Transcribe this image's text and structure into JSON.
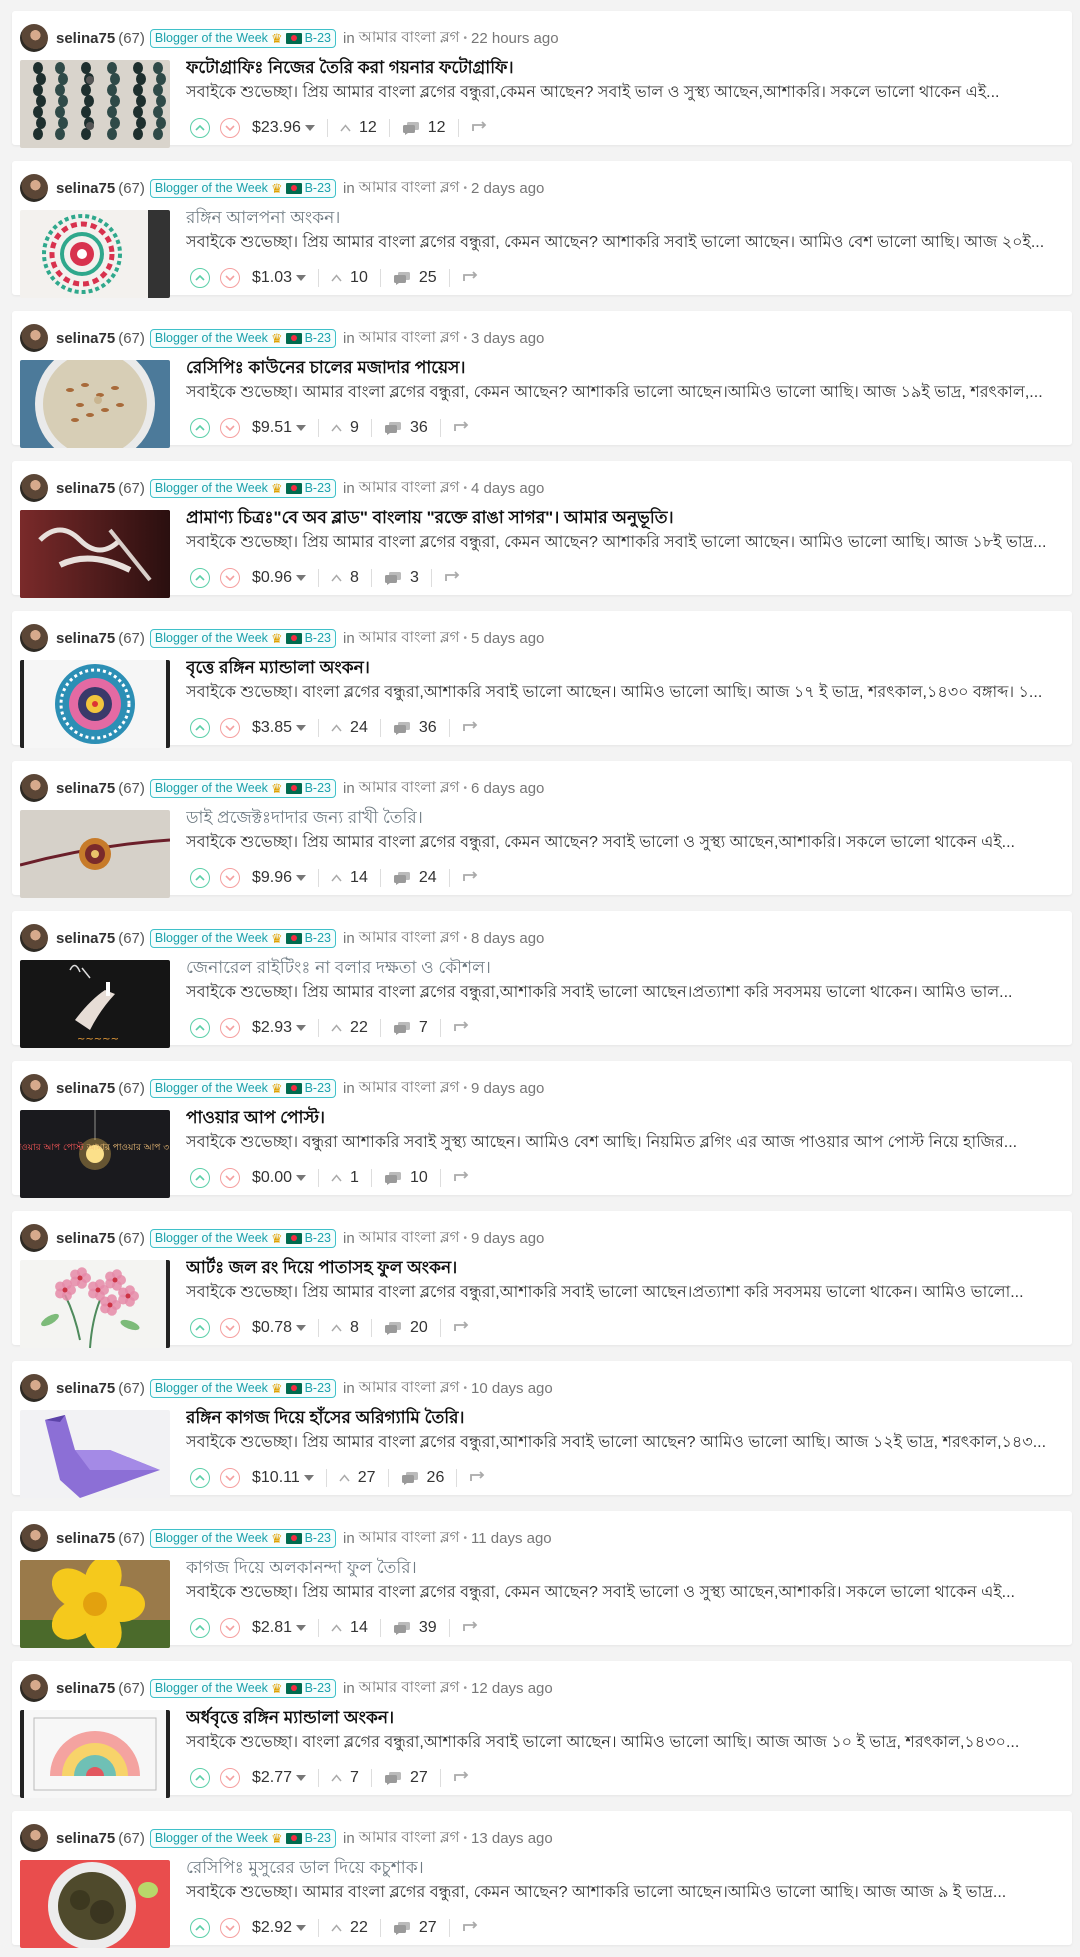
{
  "feed": {
    "posts": [
      {
        "author": "selina75",
        "reputation": "(67)",
        "badge": "Blogger of the Week",
        "badge_tag": "B-23",
        "in_label": "in",
        "community": "আমার বাংলা ব্লগ",
        "time": "22 hours ago",
        "title": "ফটোগ্রাফিঃ নিজের তৈরি করা গয়নার ফটোগ্রাফি।",
        "excerpt": "সবাইকে শুভেচ্ছা। প্রিয় আমার বাংলা ব্লগের বন্ধুরা,কেমন আছেন? সবাই ভাল ও সুস্থ্য আছেন,আশাকরি। সকলে ভালো থাকেন এই...",
        "payout": "$23.96",
        "votes": "12",
        "comments": "12",
        "thumb": "earrings",
        "visited": false
      },
      {
        "author": "selina75",
        "reputation": "(67)",
        "badge": "Blogger of the Week",
        "badge_tag": "B-23",
        "in_label": "in",
        "community": "আমার বাংলা ব্লগ",
        "time": "2 days ago",
        "title": "রঙ্গিন আলপনা অংকন।",
        "excerpt": "সবাইকে শুভেচ্ছা। প্রিয় আমার বাংলা ব্লগের বন্ধুরা, কেমন আছেন? আশাকরি সবাই ভালো আছেন। আমিও বেশ ভালো আছি। আজ ২০ই...",
        "payout": "$1.03",
        "votes": "10",
        "comments": "25",
        "thumb": "alpona",
        "visited": true
      },
      {
        "author": "selina75",
        "reputation": "(67)",
        "badge": "Blogger of the Week",
        "badge_tag": "B-23",
        "in_label": "in",
        "community": "আমার বাংলা ব্লগ",
        "time": "3 days ago",
        "title": "রেসিপিঃ কাউনের চালের মজাদার পায়েস।",
        "excerpt": "সবাইকে শুভেচ্ছা। আমার বাংলা ব্লগের বন্ধুরা, কেমন আছেন? আশাকরি ভালো আছেন।আমিও ভালো আছি। আজ ১৯ই ভাদ্র, শরৎকাল,...",
        "payout": "$9.51",
        "votes": "9",
        "comments": "36",
        "thumb": "payesh",
        "visited": false
      },
      {
        "author": "selina75",
        "reputation": "(67)",
        "badge": "Blogger of the Week",
        "badge_tag": "B-23",
        "in_label": "in",
        "community": "আমার বাংলা ব্লগ",
        "time": "4 days ago",
        "title": "প্রামাণ্য চিত্রঃ\"বে অব ব্লাড\" বাংলায় \"রক্তে রাঙা সাগর\"। আমার অনুভূতি।",
        "excerpt": "সবাইকে শুভেচ্ছা। প্রিয় আমার বাংলা ব্লগের বন্ধুরা, কেমন আছেন? আশাকরি সবাই ভালো আছেন। আমিও ভালো আছি। আজ ১৮ই ভাদ্র...",
        "payout": "$0.96",
        "votes": "8",
        "comments": "3",
        "thumb": "film",
        "visited": false
      },
      {
        "author": "selina75",
        "reputation": "(67)",
        "badge": "Blogger of the Week",
        "badge_tag": "B-23",
        "in_label": "in",
        "community": "আমার বাংলা ব্লগ",
        "time": "5 days ago",
        "title": "বৃত্তে রঙ্গিন ম্যান্ডালা অংকন।",
        "excerpt": "সবাইকে শুভেচ্ছা। বাংলা ব্লগের বন্ধুরা,আশাকরি সবাই ভালো আছেন। আমিও ভালো আছি। আজ ১৭ ই ভাদ্র, শরৎকাল,১৪৩০ বঙ্গাব্দ। ১...",
        "payout": "$3.85",
        "votes": "24",
        "comments": "36",
        "thumb": "mandala",
        "visited": false
      },
      {
        "author": "selina75",
        "reputation": "(67)",
        "badge": "Blogger of the Week",
        "badge_tag": "B-23",
        "in_label": "in",
        "community": "আমার বাংলা ব্লগ",
        "time": "6 days ago",
        "title": "ডাই প্রজেক্টঃদাদার জন্য রাখী তৈরি।",
        "excerpt": "সবাইকে শুভেচ্ছা। প্রিয় আমার বাংলা ব্লগের বন্ধুরা, কেমন আছেন? সবাই ভালো ও সুস্থ্য আছেন,আশাকরি। সকলে ভালো থাকেন এই...",
        "payout": "$9.96",
        "votes": "14",
        "comments": "24",
        "thumb": "rakhi",
        "visited": true
      },
      {
        "author": "selina75",
        "reputation": "(67)",
        "badge": "Blogger of the Week",
        "badge_tag": "B-23",
        "in_label": "in",
        "community": "আমার বাংলা ব্লগ",
        "time": "8 days ago",
        "title": "জেনারেল রাইটিংঃ না বলার দক্ষতা ও কৌশল।",
        "excerpt": "সবাইকে শুভেচ্ছা। প্রিয় আমার বাংলা ব্লগের বন্ধুরা,আশাকরি সবাই ভালো আছেন।প্রত্যাশা করি সবসময় ভালো থাকেন। আমিও ভাল...",
        "payout": "$2.93",
        "votes": "22",
        "comments": "7",
        "thumb": "chalkboard",
        "visited": true
      },
      {
        "author": "selina75",
        "reputation": "(67)",
        "badge": "Blogger of the Week",
        "badge_tag": "B-23",
        "in_label": "in",
        "community": "আমার বাংলা ব্লগ",
        "time": "9 days ago",
        "title": "পাওয়ার আপ পোস্ট।",
        "excerpt": "সবাইকে শুভেচ্ছা। বন্ধুরা আশাকরি সবাই সুস্থ্য আছেন। আমিও বেশ আছি। নিয়মিত ব্লগিং এর আজ পাওয়ার আপ পোস্ট নিয়ে হাজির...",
        "payout": "$0.00",
        "votes": "1",
        "comments": "10",
        "thumb": "bulb",
        "visited": false
      },
      {
        "author": "selina75",
        "reputation": "(67)",
        "badge": "Blogger of the Week",
        "badge_tag": "B-23",
        "in_label": "in",
        "community": "আমার বাংলা ব্লগ",
        "time": "9 days ago",
        "title": "আর্টঃ জল রং দিয়ে পাতাসহ ফুল অংকন।",
        "excerpt": "সবাইকে শুভেচ্ছা। প্রিয় আমার বাংলা ব্লগের বন্ধুরা,আশাকরি সবাই ভালো আছেন।প্রত্যাশা করি সবসময় ভালো থাকেন। আমিও ভালো...",
        "payout": "$0.78",
        "votes": "8",
        "comments": "20",
        "thumb": "flowers",
        "visited": false
      },
      {
        "author": "selina75",
        "reputation": "(67)",
        "badge": "Blogger of the Week",
        "badge_tag": "B-23",
        "in_label": "in",
        "community": "আমার বাংলা ব্লগ",
        "time": "10 days ago",
        "title": "রঙ্গিন কাগজ দিয়ে হাঁসের অরিগ্যামি তৈরি।",
        "excerpt": "সবাইকে শুভেচ্ছা। প্রিয় আমার বাংলা ব্লগের বন্ধুরা,আশাকরি সবাই ভালো আছেন? আমিও ভালো আছি। আজ ১২ই ভাদ্র, শরৎকাল,১৪৩...",
        "payout": "$10.11",
        "votes": "27",
        "comments": "26",
        "thumb": "origami",
        "visited": false
      },
      {
        "author": "selina75",
        "reputation": "(67)",
        "badge": "Blogger of the Week",
        "badge_tag": "B-23",
        "in_label": "in",
        "community": "আমার বাংলা ব্লগ",
        "time": "11 days ago",
        "title": "কাগজ দিয়ে অলকানন্দা ফুল তৈরি।",
        "excerpt": "সবাইকে শুভেচ্ছা। প্রিয় আমার বাংলা ব্লগের বন্ধুরা, কেমন আছেন? সবাই ভালো ও সুস্থ্য আছেন,আশাকরি। সকলে ভালো থাকেন এই...",
        "payout": "$2.81",
        "votes": "14",
        "comments": "39",
        "thumb": "yellowflower",
        "visited": true
      },
      {
        "author": "selina75",
        "reputation": "(67)",
        "badge": "Blogger of the Week",
        "badge_tag": "B-23",
        "in_label": "in",
        "community": "আমার বাংলা ব্লগ",
        "time": "12 days ago",
        "title": "অর্ধবৃত্তে রঙ্গিন ম্যান্ডালা অংকন।",
        "excerpt": "সবাইকে শুভেচ্ছা। বাংলা ব্লগের বন্ধুরা,আশাকরি সবাই ভালো আছেন। আমিও ভালো আছি। আজ আজ ১০ ই ভাদ্র, শরৎকাল,১৪৩০...",
        "payout": "$2.77",
        "votes": "7",
        "comments": "27",
        "thumb": "halfmandala",
        "visited": false
      },
      {
        "author": "selina75",
        "reputation": "(67)",
        "badge": "Blogger of the Week",
        "badge_tag": "B-23",
        "in_label": "in",
        "community": "আমার বাংলা ব্লগ",
        "time": "13 days ago",
        "title": "রেসিপিঃ মুসুরের ডাল দিয়ে কচুশাক।",
        "excerpt": "সবাইকে শুভেচ্ছা। আমার বাংলা ব্লগের বন্ধুরা, কেমন আছেন? আশাকরি ভালো আছেন।আমিও ভালো আছি। আজ আজ ৯ ই ভাদ্র...",
        "payout": "$2.92",
        "votes": "22",
        "comments": "27",
        "thumb": "kochushak",
        "visited": true
      }
    ],
    "colors": {
      "upvote": "#5ccfa9",
      "downvote": "#f5a0a0",
      "badge": "#1aa1aa",
      "background": "#f3f3f3"
    },
    "bulb_text_left": "পাওয়ার আপ পোস্ট",
    "bulb_text_right": "আমার পাওয়ার আপ ৩৫ টিয়া"
  }
}
